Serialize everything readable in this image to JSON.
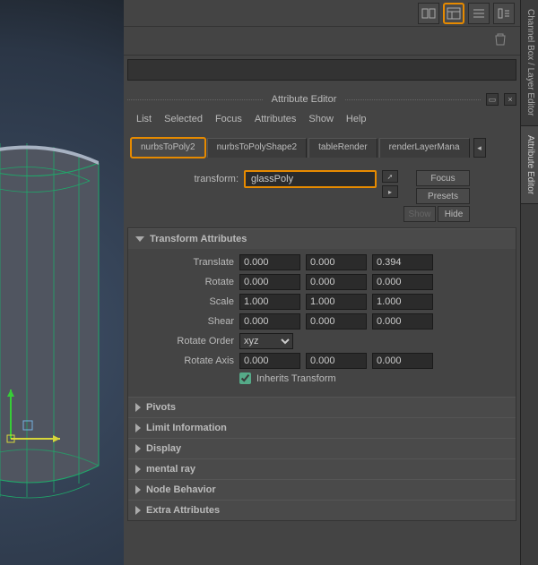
{
  "topbar": {
    "icons": [
      "layout-icon",
      "attr-editor-icon",
      "list-icon",
      "tool-settings-icon"
    ]
  },
  "attribute_editor": {
    "title": "Attribute Editor",
    "menu": [
      "List",
      "Selected",
      "Focus",
      "Attributes",
      "Show",
      "Help"
    ],
    "tabs": [
      "nurbsToPoly2",
      "nurbsToPolyShape2",
      "tableRender",
      "renderLayerMana"
    ],
    "active_tab_index": 0,
    "transform_label": "transform:",
    "transform_name": "glassPoly",
    "buttons": {
      "focus": "Focus",
      "presets": "Presets",
      "show": "Show",
      "hide": "Hide"
    },
    "sections": {
      "transform_attrs": {
        "title": "Transform Attributes",
        "rows": {
          "translate": {
            "label": "Translate",
            "x": "0.000",
            "y": "0.000",
            "z": "0.394"
          },
          "rotate": {
            "label": "Rotate",
            "x": "0.000",
            "y": "0.000",
            "z": "0.000"
          },
          "scale": {
            "label": "Scale",
            "x": "1.000",
            "y": "1.000",
            "z": "1.000"
          },
          "shear": {
            "label": "Shear",
            "x": "0.000",
            "y": "0.000",
            "z": "0.000"
          },
          "rotate_order": {
            "label": "Rotate Order",
            "value": "xyz"
          },
          "rotate_axis": {
            "label": "Rotate Axis",
            "x": "0.000",
            "y": "0.000",
            "z": "0.000"
          },
          "inherits": {
            "label": "Inherits Transform",
            "value": true
          }
        }
      },
      "collapsed": [
        "Pivots",
        "Limit Information",
        "Display",
        "mental ray",
        "Node Behavior",
        "Extra Attributes"
      ]
    }
  },
  "side_tabs": [
    "Channel Box / Layer Editor",
    "Attribute Editor"
  ]
}
